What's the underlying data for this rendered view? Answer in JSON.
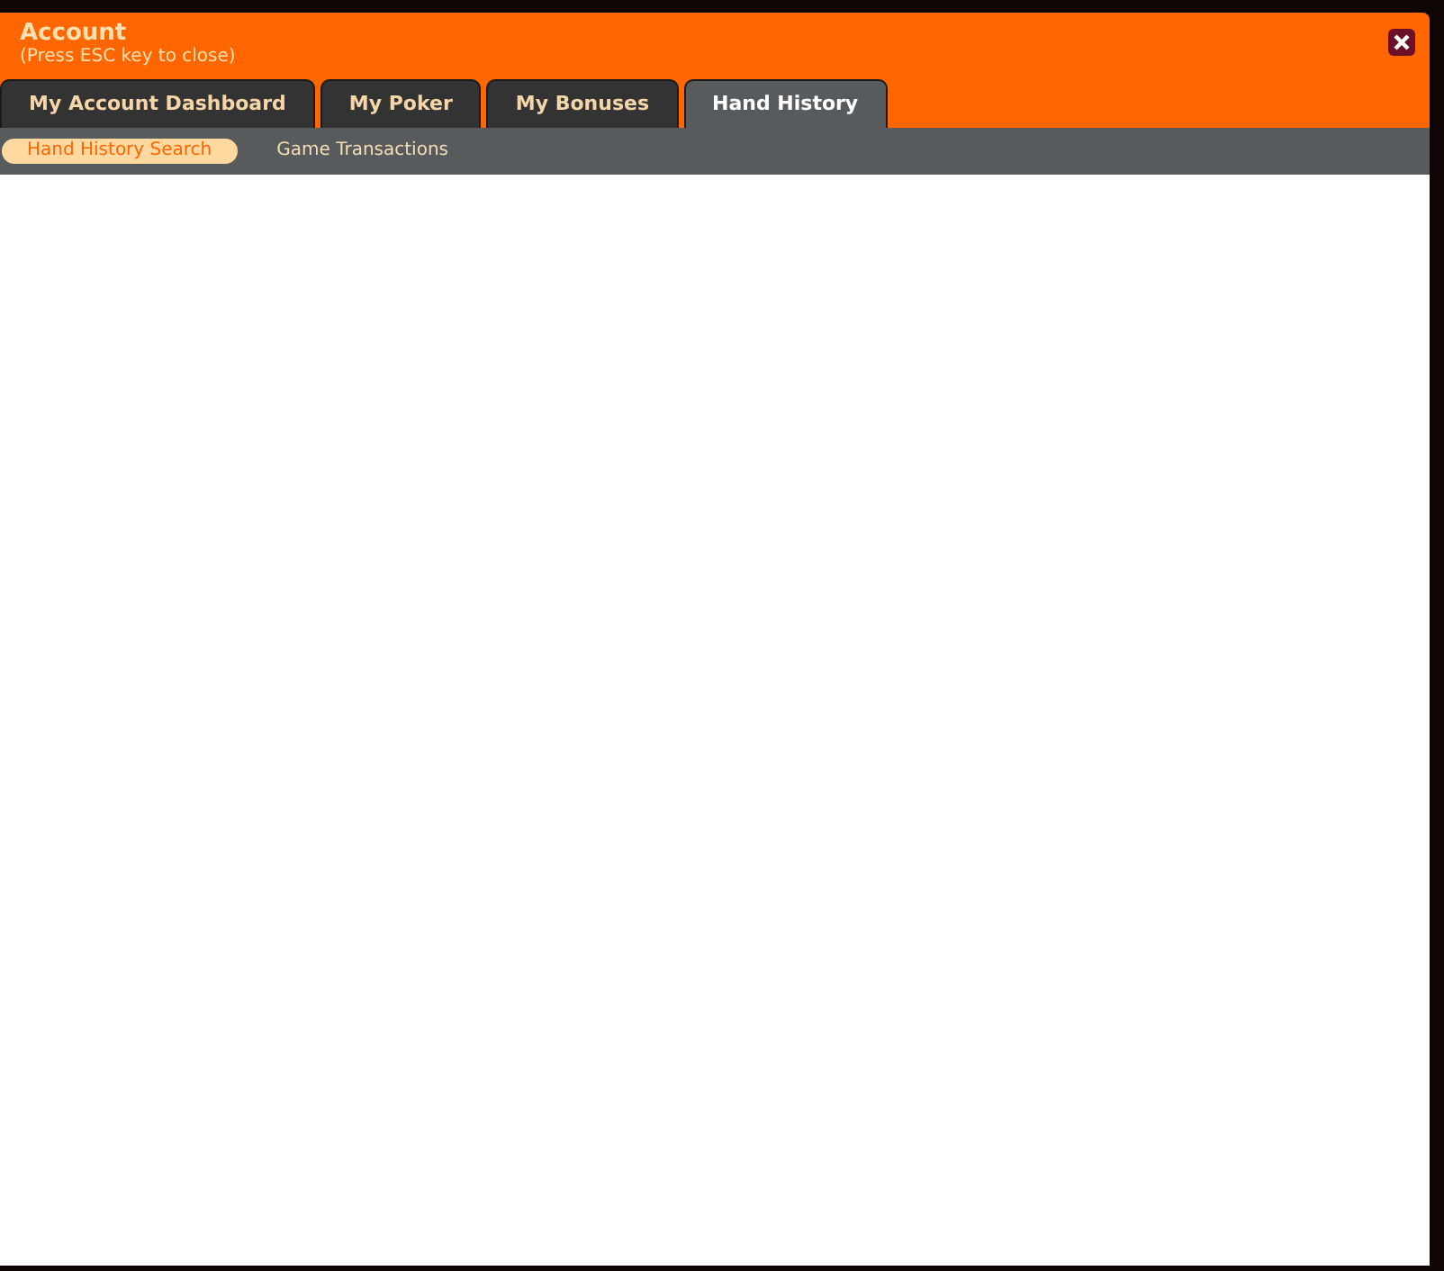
{
  "window": {
    "title": "Account",
    "subtitle": "(Press ESC key to close)"
  },
  "tabs": [
    {
      "label": "My Account Dashboard",
      "selected": false
    },
    {
      "label": "My Poker",
      "selected": false
    },
    {
      "label": "My Bonuses",
      "selected": false
    },
    {
      "label": "Hand History",
      "selected": true
    }
  ],
  "subtabs": [
    {
      "label": "Hand History Search",
      "selected": true
    },
    {
      "label": "Game Transactions",
      "selected": false
    }
  ]
}
